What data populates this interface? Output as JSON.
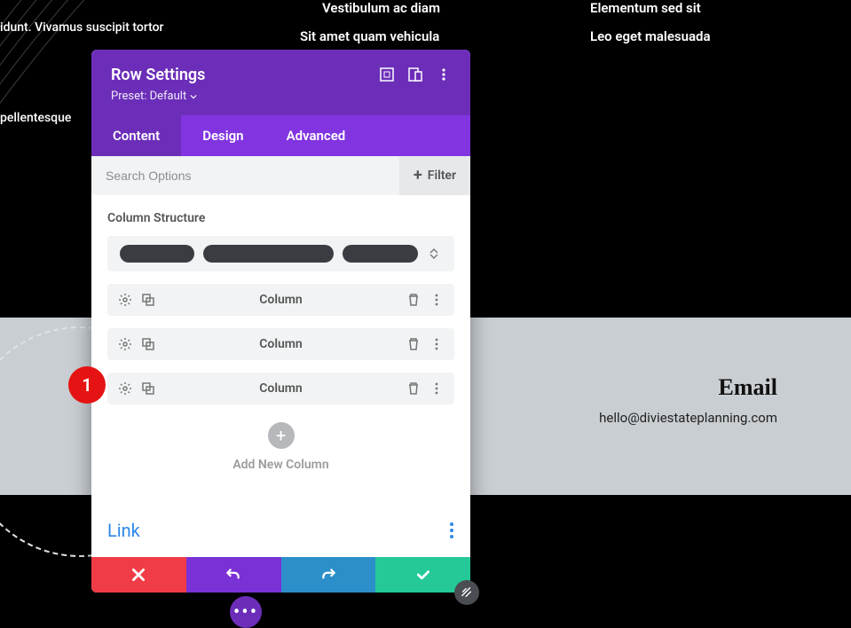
{
  "page_bg": {
    "text1": "idunt. Vivamus suscipit tortor",
    "text2": "Vestibulum ac diam",
    "text3": "Elementum sed sit",
    "text4": "Sit amet quam vehicula",
    "text5": "Leo eget malesuada",
    "text6": "pellentesque",
    "email_heading": "Email",
    "email_value": "hello@diviestateplanning.com"
  },
  "modal": {
    "title": "Row Settings",
    "preset_label": "Preset: Default",
    "tabs": {
      "content": "Content",
      "design": "Design",
      "advanced": "Advanced",
      "active": "content"
    },
    "search_placeholder": "Search Options",
    "filter_label": "Filter",
    "column_structure_label": "Column Structure",
    "columns": [
      {
        "label": "Column"
      },
      {
        "label": "Column"
      },
      {
        "label": "Column"
      }
    ],
    "add_column_label": "Add New Column",
    "link_section_title": "Link"
  },
  "badge": {
    "number": "1"
  },
  "icons": {
    "expand": "expand-icon",
    "responsive": "responsive-icon",
    "more_v": "more-vertical-icon",
    "chevron_down": "chevron-down-icon",
    "gear": "gear-icon",
    "duplicate": "duplicate-icon",
    "trash": "trash-icon",
    "plus": "plus-icon",
    "close": "close-icon",
    "undo": "undo-icon",
    "redo": "redo-icon",
    "check": "check-icon",
    "resize": "resize-icon",
    "ellipsis": "ellipsis-icon"
  }
}
